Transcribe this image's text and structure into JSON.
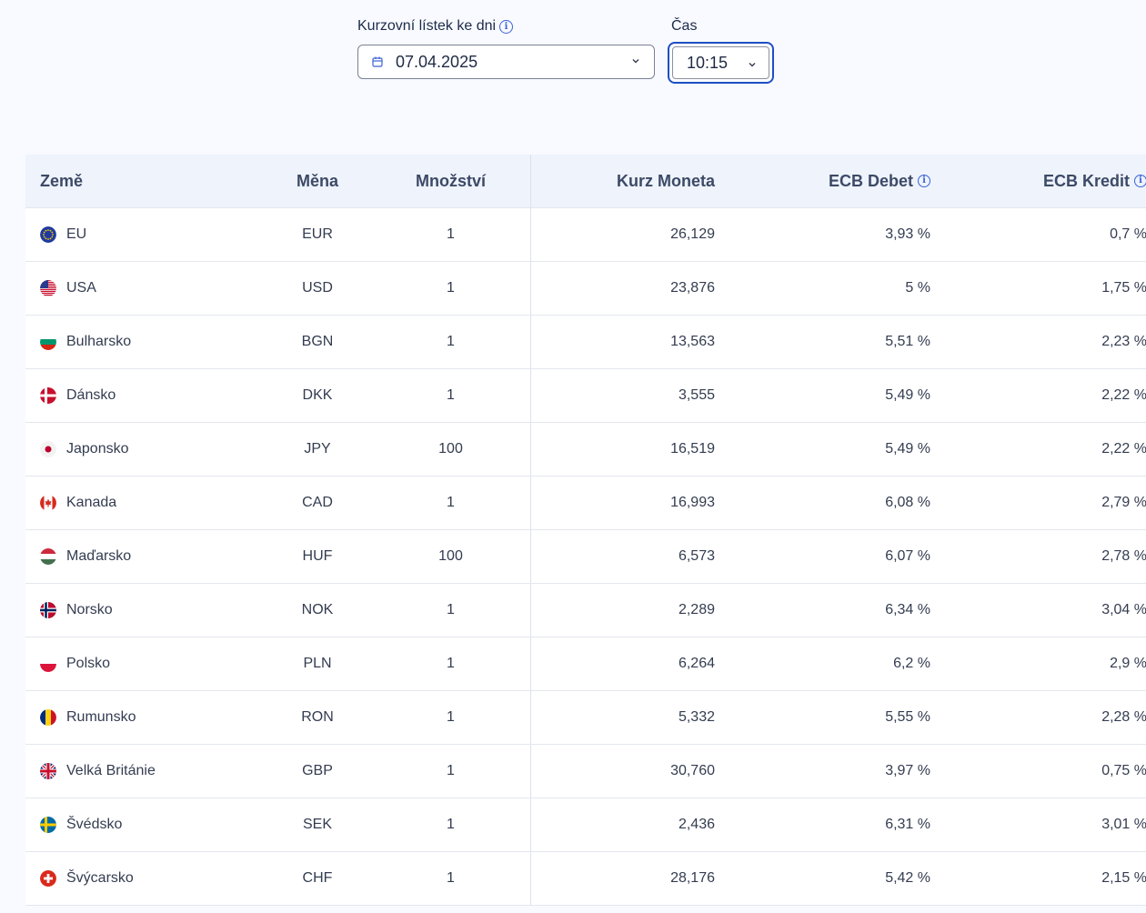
{
  "filters": {
    "date_label": "Kurzovní lístek ke dni",
    "date_value": "07.04.2025",
    "time_label": "Čas",
    "time_value": "10:15"
  },
  "table": {
    "headers": {
      "country": "Země",
      "currency": "Měna",
      "quantity": "Množství",
      "rate": "Kurz Moneta",
      "ecb_debit": "ECB Debet",
      "ecb_credit": "ECB Kredit"
    },
    "rows": [
      {
        "country": "EU",
        "flag": "eu-flag-icon",
        "currency": "EUR",
        "quantity": "1",
        "rate": "26,129",
        "debit": "3,93 %",
        "credit": "0,7 %"
      },
      {
        "country": "USA",
        "flag": "us-flag-icon",
        "currency": "USD",
        "quantity": "1",
        "rate": "23,876",
        "debit": "5 %",
        "credit": "1,75 %"
      },
      {
        "country": "Bulharsko",
        "flag": "bg-flag-icon",
        "currency": "BGN",
        "quantity": "1",
        "rate": "13,563",
        "debit": "5,51 %",
        "credit": "2,23 %"
      },
      {
        "country": "Dánsko",
        "flag": "dk-flag-icon",
        "currency": "DKK",
        "quantity": "1",
        "rate": "3,555",
        "debit": "5,49 %",
        "credit": "2,22 %"
      },
      {
        "country": "Japonsko",
        "flag": "jp-flag-icon",
        "currency": "JPY",
        "quantity": "100",
        "rate": "16,519",
        "debit": "5,49 %",
        "credit": "2,22 %"
      },
      {
        "country": "Kanada",
        "flag": "ca-flag-icon",
        "currency": "CAD",
        "quantity": "1",
        "rate": "16,993",
        "debit": "6,08 %",
        "credit": "2,79 %"
      },
      {
        "country": "Maďarsko",
        "flag": "hu-flag-icon",
        "currency": "HUF",
        "quantity": "100",
        "rate": "6,573",
        "debit": "6,07 %",
        "credit": "2,78 %"
      },
      {
        "country": "Norsko",
        "flag": "no-flag-icon",
        "currency": "NOK",
        "quantity": "1",
        "rate": "2,289",
        "debit": "6,34 %",
        "credit": "3,04 %"
      },
      {
        "country": "Polsko",
        "flag": "pl-flag-icon",
        "currency": "PLN",
        "quantity": "1",
        "rate": "6,264",
        "debit": "6,2 %",
        "credit": "2,9 %"
      },
      {
        "country": "Rumunsko",
        "flag": "ro-flag-icon",
        "currency": "RON",
        "quantity": "1",
        "rate": "5,332",
        "debit": "5,55 %",
        "credit": "2,28 %"
      },
      {
        "country": "Velká Británie",
        "flag": "gb-flag-icon",
        "currency": "GBP",
        "quantity": "1",
        "rate": "30,760",
        "debit": "3,97 %",
        "credit": "0,75 %"
      },
      {
        "country": "Švédsko",
        "flag": "se-flag-icon",
        "currency": "SEK",
        "quantity": "1",
        "rate": "2,436",
        "debit": "6,31 %",
        "credit": "3,01 %"
      },
      {
        "country": "Švýcarsko",
        "flag": "ch-flag-icon",
        "currency": "CHF",
        "quantity": "1",
        "rate": "28,176",
        "debit": "5,42 %",
        "credit": "2,15 %"
      }
    ]
  },
  "colors": {
    "accent": "#1d4fc4",
    "header_bg": "#eef3fc",
    "page_bg": "#f8faff"
  }
}
